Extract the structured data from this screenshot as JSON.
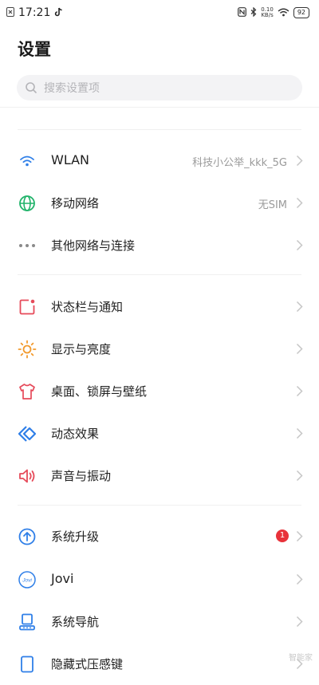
{
  "status_bar": {
    "time": "17:21",
    "net_speed_value": "0.10",
    "net_speed_unit": "KB/s",
    "battery": "92"
  },
  "header": {
    "title": "设置",
    "search_placeholder": "搜索设置项"
  },
  "sections": [
    {
      "items": [
        {
          "label": "WLAN",
          "value": "科技小公举_kkk_5G",
          "icon": "wifi-icon",
          "color": "#2f7fe8"
        },
        {
          "label": "移动网络",
          "value": "无SIM",
          "icon": "globe-icon",
          "color": "#21b36a"
        },
        {
          "label": "其他网络与连接",
          "icon": "more-dots-icon",
          "color": "#8a8a8a"
        }
      ]
    },
    {
      "items": [
        {
          "label": "状态栏与通知",
          "icon": "notification-icon",
          "color": "#e64a5a"
        },
        {
          "label": "显示与亮度",
          "icon": "sun-icon",
          "color": "#f29a2e"
        },
        {
          "label": "桌面、锁屏与壁纸",
          "icon": "tshirt-icon",
          "color": "#e64a5a"
        },
        {
          "label": "动态效果",
          "icon": "animation-icon",
          "color": "#2f7fe8"
        },
        {
          "label": "声音与振动",
          "icon": "speaker-icon",
          "color": "#e64a5a"
        }
      ]
    },
    {
      "items": [
        {
          "label": "系统升级",
          "badge": "1",
          "icon": "upgrade-icon",
          "color": "#2f7fe8"
        },
        {
          "label": "Jovi",
          "icon": "jovi-icon",
          "color": "#2f7fe8"
        },
        {
          "label": "系统导航",
          "icon": "navigation-icon",
          "color": "#2f7fe8"
        },
        {
          "label": "隐藏式压感键",
          "icon": "pressure-key-icon",
          "color": "#2f7fe8"
        }
      ]
    }
  ],
  "watermark": "智能家"
}
